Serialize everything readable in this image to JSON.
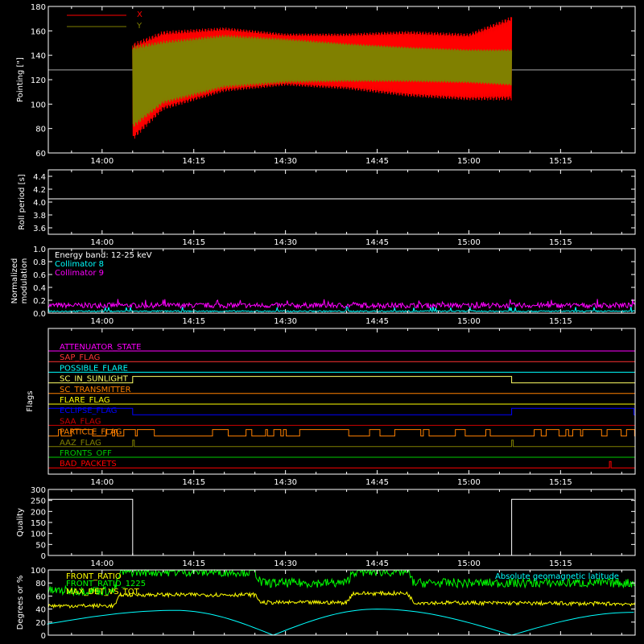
{
  "chart_data": [
    {
      "id": "pointing",
      "type": "line",
      "ylabel": "Pointing [\"]",
      "ylim": [
        60,
        180
      ],
      "y_ticks": [
        60,
        80,
        100,
        120,
        140,
        160,
        180
      ],
      "x_tick_labels": [
        "14:00",
        "14:15",
        "14:30",
        "14:45",
        "15:00",
        "15:15"
      ],
      "reference_line": 128,
      "legend": [
        {
          "name": "X",
          "color": "#ff0000"
        },
        {
          "name": "Y",
          "color": "#808000"
        }
      ],
      "series": [
        {
          "name": "X",
          "color": "#ff0000",
          "time": [
            "14:05",
            "14:10",
            "14:20",
            "14:30",
            "14:40",
            "14:50",
            "15:00",
            "15:07"
          ],
          "min": [
            70,
            95,
            110,
            115,
            112,
            106,
            103,
            103
          ],
          "max": [
            150,
            160,
            163,
            158,
            158,
            160,
            158,
            172
          ]
        },
        {
          "name": "Y",
          "color": "#808000",
          "time": [
            "14:05",
            "14:10",
            "14:20",
            "14:30",
            "14:40",
            "14:50",
            "15:00",
            "15:07"
          ],
          "min": [
            80,
            100,
            113,
            117,
            118,
            118,
            117,
            115
          ],
          "max": [
            148,
            152,
            157,
            154,
            150,
            147,
            145,
            145
          ]
        }
      ]
    },
    {
      "id": "roll-period",
      "type": "line",
      "ylabel": "Roll period [s]",
      "ylim": [
        3.5,
        4.5
      ],
      "y_ticks": [
        3.6,
        3.8,
        4.0,
        4.2,
        4.4
      ],
      "x_tick_labels": [
        "14:00",
        "14:15",
        "14:30",
        "14:45",
        "15:00",
        "15:15"
      ],
      "series": [
        {
          "name": "",
          "color": "#ffffff",
          "constant": 4.05
        }
      ]
    },
    {
      "id": "modulation",
      "type": "line",
      "ylabel": "Normalized modulation",
      "ylim": [
        0,
        1
      ],
      "y_ticks": [
        0.0,
        0.2,
        0.4,
        0.6,
        0.8,
        1.0
      ],
      "x_tick_labels": [
        "14:00",
        "14:15",
        "14:30",
        "14:45",
        "15:00",
        "15:15"
      ],
      "annotations": [
        {
          "text": "Energy band: 12-25 keV",
          "color": "#ffffff"
        },
        {
          "text": "Collimator 8",
          "color": "#00ffff"
        },
        {
          "text": "Collimator 9",
          "color": "#ff00ff"
        }
      ],
      "series": [
        {
          "name": "Collimator 9",
          "color": "#ff00ff",
          "mean": 0.12
        },
        {
          "name": "Collimator 8",
          "color": "#00ffff",
          "mean": 0.03
        }
      ]
    },
    {
      "id": "flags",
      "type": "line",
      "ylabel": "Flags",
      "x_tick_labels": [
        "14:00",
        "14:15",
        "14:30",
        "14:45",
        "15:00",
        "15:15"
      ],
      "flags": [
        {
          "name": "ATTENUATOR_STATE",
          "color": "#ff00ff"
        },
        {
          "name": "SAP_FLAG",
          "color": "#ff3333"
        },
        {
          "name": "POSSIBLE_FLARE",
          "color": "#00ffff"
        },
        {
          "name": "SC_IN_SUNLIGHT",
          "color": "#ffff66",
          "high": [
            [
              "14:05",
              "15:07"
            ]
          ]
        },
        {
          "name": "SC_TRANSMITTER",
          "color": "#ff8000"
        },
        {
          "name": "FLARE_FLAG",
          "color": "#ffff00"
        },
        {
          "name": "ECLIPSE_FLAG",
          "color": "#0000ff",
          "high": [
            [
              "13:51",
              "14:05"
            ],
            [
              "15:07",
              "15:27"
            ]
          ]
        },
        {
          "name": "SAA_FLAG",
          "color": "#cc0000"
        },
        {
          "name": "PARTICLE_FLAG",
          "color": "#ff8000",
          "spiky": true
        },
        {
          "name": "AAZ_FLAG",
          "color": "#808000",
          "high": [
            [
              "14:05",
              "14:05"
            ],
            [
              "15:07",
              "15:07"
            ]
          ]
        },
        {
          "name": "FRONTS_OFF",
          "color": "#00cc00"
        },
        {
          "name": "BAD_PACKETS",
          "color": "#ff0000",
          "high": [
            [
              "15:23",
              "15:23"
            ]
          ]
        }
      ]
    },
    {
      "id": "quality",
      "type": "line",
      "ylabel": "Quality",
      "ylim": [
        0,
        300
      ],
      "y_ticks": [
        0,
        50,
        100,
        150,
        200,
        250,
        300
      ],
      "x_tick_labels": [
        "14:00",
        "14:15",
        "14:30",
        "14:45",
        "15:00",
        "15:15"
      ],
      "series": [
        {
          "name": "",
          "color": "#ffffff",
          "time": [
            "13:51",
            "14:05",
            "14:05",
            "15:07",
            "15:07",
            "15:27"
          ],
          "values": [
            255,
            255,
            0,
            0,
            255,
            255
          ]
        }
      ]
    },
    {
      "id": "ratios",
      "type": "line",
      "ylabel": "Degrees or %",
      "ylim": [
        0,
        100
      ],
      "y_ticks": [
        0,
        20,
        40,
        60,
        80,
        100
      ],
      "annotations": [
        {
          "text": "FRONT_RATIO",
          "color": "#ffff00"
        },
        {
          "text": "FRONT_RATIO_1225",
          "color": "#00ff00"
        },
        {
          "text": "MAX_DET_VS_TOT",
          "color": "#ffff00"
        },
        {
          "text": "Absolute geomagnetic latitude",
          "color": "#00ffff"
        }
      ],
      "series": [
        {
          "name": "FRONT_RATIO_1225",
          "color": "#00ff00",
          "time": [
            "13:51",
            "14:02",
            "14:03",
            "14:25",
            "14:26",
            "14:40",
            "14:41",
            "14:50",
            "14:51",
            "15:27"
          ],
          "values": [
            68,
            68,
            97,
            97,
            80,
            80,
            97,
            97,
            80,
            80
          ]
        },
        {
          "name": "MAX_DET_VS_TOT",
          "color": "#ffff00",
          "time": [
            "13:51",
            "14:02",
            "14:03",
            "14:25",
            "14:26",
            "14:40",
            "14:41",
            "14:50",
            "14:51",
            "15:27"
          ],
          "values": [
            45,
            45,
            62,
            62,
            50,
            50,
            64,
            64,
            50,
            48
          ]
        },
        {
          "name": "Absolute geomagnetic latitude",
          "color": "#00ffff",
          "time": [
            "13:51",
            "14:12",
            "14:28",
            "14:45",
            "15:07",
            "15:27"
          ],
          "values": [
            17,
            38,
            0,
            40,
            0,
            35
          ]
        }
      ]
    }
  ]
}
